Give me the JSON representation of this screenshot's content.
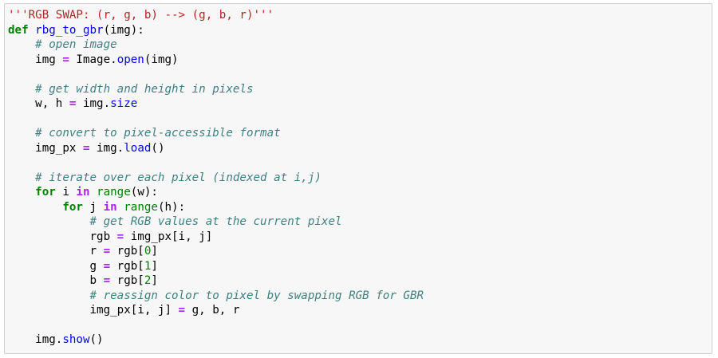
{
  "cell": {
    "lines": [
      [
        {
          "t": "'''RGB SWAP: (r, g, b) --> (g, b, r)'''",
          "c": "str"
        }
      ],
      [
        {
          "t": "def",
          "c": "kw"
        },
        {
          "t": " ",
          "c": "plain"
        },
        {
          "t": "rbg_to_gbr",
          "c": "def"
        },
        {
          "t": "(img):",
          "c": "plain"
        }
      ],
      [
        {
          "t": "    ",
          "c": "plain"
        },
        {
          "t": "# open image",
          "c": "com"
        }
      ],
      [
        {
          "t": "    img ",
          "c": "plain"
        },
        {
          "t": "=",
          "c": "op"
        },
        {
          "t": " Image.",
          "c": "plain"
        },
        {
          "t": "open",
          "c": "attr"
        },
        {
          "t": "(img)",
          "c": "plain"
        }
      ],
      [],
      [
        {
          "t": "    ",
          "c": "plain"
        },
        {
          "t": "# get width and height in pixels",
          "c": "com"
        }
      ],
      [
        {
          "t": "    w, h ",
          "c": "plain"
        },
        {
          "t": "=",
          "c": "op"
        },
        {
          "t": " img.",
          "c": "plain"
        },
        {
          "t": "size",
          "c": "attr"
        }
      ],
      [],
      [
        {
          "t": "    ",
          "c": "plain"
        },
        {
          "t": "# convert to pixel-accessible format",
          "c": "com"
        }
      ],
      [
        {
          "t": "    img_px ",
          "c": "plain"
        },
        {
          "t": "=",
          "c": "op"
        },
        {
          "t": " img.",
          "c": "plain"
        },
        {
          "t": "load",
          "c": "attr"
        },
        {
          "t": "()",
          "c": "plain"
        }
      ],
      [],
      [
        {
          "t": "    ",
          "c": "plain"
        },
        {
          "t": "# iterate over each pixel (indexed at i,j)",
          "c": "com"
        }
      ],
      [
        {
          "t": "    ",
          "c": "plain"
        },
        {
          "t": "for",
          "c": "kw"
        },
        {
          "t": " i ",
          "c": "plain"
        },
        {
          "t": "in",
          "c": "op"
        },
        {
          "t": " ",
          "c": "plain"
        },
        {
          "t": "range",
          "c": "fn"
        },
        {
          "t": "(w):",
          "c": "plain"
        }
      ],
      [
        {
          "t": "        ",
          "c": "plain"
        },
        {
          "t": "for",
          "c": "kw"
        },
        {
          "t": " j ",
          "c": "plain"
        },
        {
          "t": "in",
          "c": "op"
        },
        {
          "t": " ",
          "c": "plain"
        },
        {
          "t": "range",
          "c": "fn"
        },
        {
          "t": "(h):",
          "c": "plain"
        }
      ],
      [
        {
          "t": "            ",
          "c": "plain"
        },
        {
          "t": "# get RGB values at the current pixel",
          "c": "com"
        }
      ],
      [
        {
          "t": "            rgb ",
          "c": "plain"
        },
        {
          "t": "=",
          "c": "op"
        },
        {
          "t": " img_px[i, j]",
          "c": "plain"
        }
      ],
      [
        {
          "t": "            r ",
          "c": "plain"
        },
        {
          "t": "=",
          "c": "op"
        },
        {
          "t": " rgb[",
          "c": "plain"
        },
        {
          "t": "0",
          "c": "num"
        },
        {
          "t": "]",
          "c": "plain"
        }
      ],
      [
        {
          "t": "            g ",
          "c": "plain"
        },
        {
          "t": "=",
          "c": "op"
        },
        {
          "t": " rgb[",
          "c": "plain"
        },
        {
          "t": "1",
          "c": "num"
        },
        {
          "t": "]",
          "c": "plain"
        }
      ],
      [
        {
          "t": "            b ",
          "c": "plain"
        },
        {
          "t": "=",
          "c": "op"
        },
        {
          "t": " rgb[",
          "c": "plain"
        },
        {
          "t": "2",
          "c": "num"
        },
        {
          "t": "]",
          "c": "plain"
        }
      ],
      [
        {
          "t": "            ",
          "c": "plain"
        },
        {
          "t": "# reassign color to pixel by swapping RGB for GBR",
          "c": "com"
        }
      ],
      [
        {
          "t": "            img_px[i, j] ",
          "c": "plain"
        },
        {
          "t": "=",
          "c": "op"
        },
        {
          "t": " g, b, r",
          "c": "plain"
        }
      ],
      [],
      [
        {
          "t": "    img.",
          "c": "plain"
        },
        {
          "t": "show",
          "c": "attr"
        },
        {
          "t": "()",
          "c": "plain"
        }
      ]
    ]
  },
  "colors": {
    "cell_background": "#f7f7f7",
    "cell_border": "#cfcfcf",
    "string": "#ba2121",
    "keyword": "#008000",
    "function_name": "#0000ff",
    "comment": "#408080",
    "operator": "#aa22ff",
    "attribute": "#0000ff",
    "builtin": "#008000",
    "number": "#008000"
  }
}
